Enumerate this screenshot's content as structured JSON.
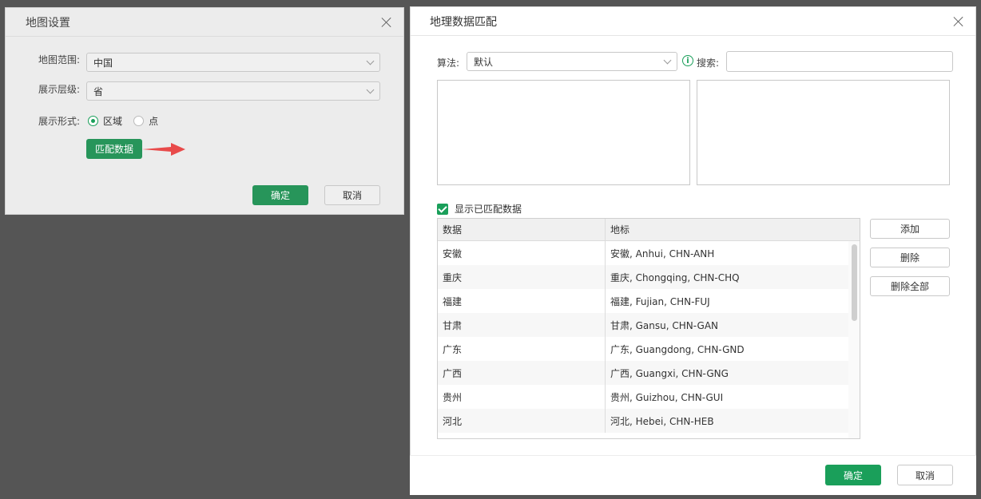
{
  "map_settings": {
    "title": "地图设置",
    "scope_label": "地图范围:",
    "scope_value": "中国",
    "level_label": "展示层级:",
    "level_value": "省",
    "display_label": "展示形式:",
    "display_options": [
      "区域",
      "点"
    ],
    "display_selected": "区域",
    "match_button": "匹配数据",
    "ok": "确定",
    "cancel": "取消"
  },
  "geo_match": {
    "title": "地理数据匹配",
    "algorithm_label": "算法:",
    "algorithm_value": "默认",
    "search_label": "搜索:",
    "search_value": "",
    "show_matched_label": "显示已匹配数据",
    "columns": [
      "数据",
      "地标"
    ],
    "rows": [
      [
        "安徽",
        "安徽, Anhui, CHN-ANH"
      ],
      [
        "重庆",
        "重庆, Chongqing, CHN-CHQ"
      ],
      [
        "福建",
        "福建, Fujian, CHN-FUJ"
      ],
      [
        "甘肃",
        "甘肃, Gansu, CHN-GAN"
      ],
      [
        "广东",
        "广东, Guangdong, CHN-GND"
      ],
      [
        "广西",
        "广西, Guangxi, CHN-GNG"
      ],
      [
        "贵州",
        "贵州, Guizhou, CHN-GUI"
      ],
      [
        "河北",
        "河北, Hebei, CHN-HEB"
      ]
    ],
    "add": "添加",
    "delete": "删除",
    "delete_all": "删除全部",
    "ok": "确定",
    "cancel": "取消"
  },
  "colors": {
    "accent": "#1a9f5a",
    "arrow": "#e84a4a"
  }
}
